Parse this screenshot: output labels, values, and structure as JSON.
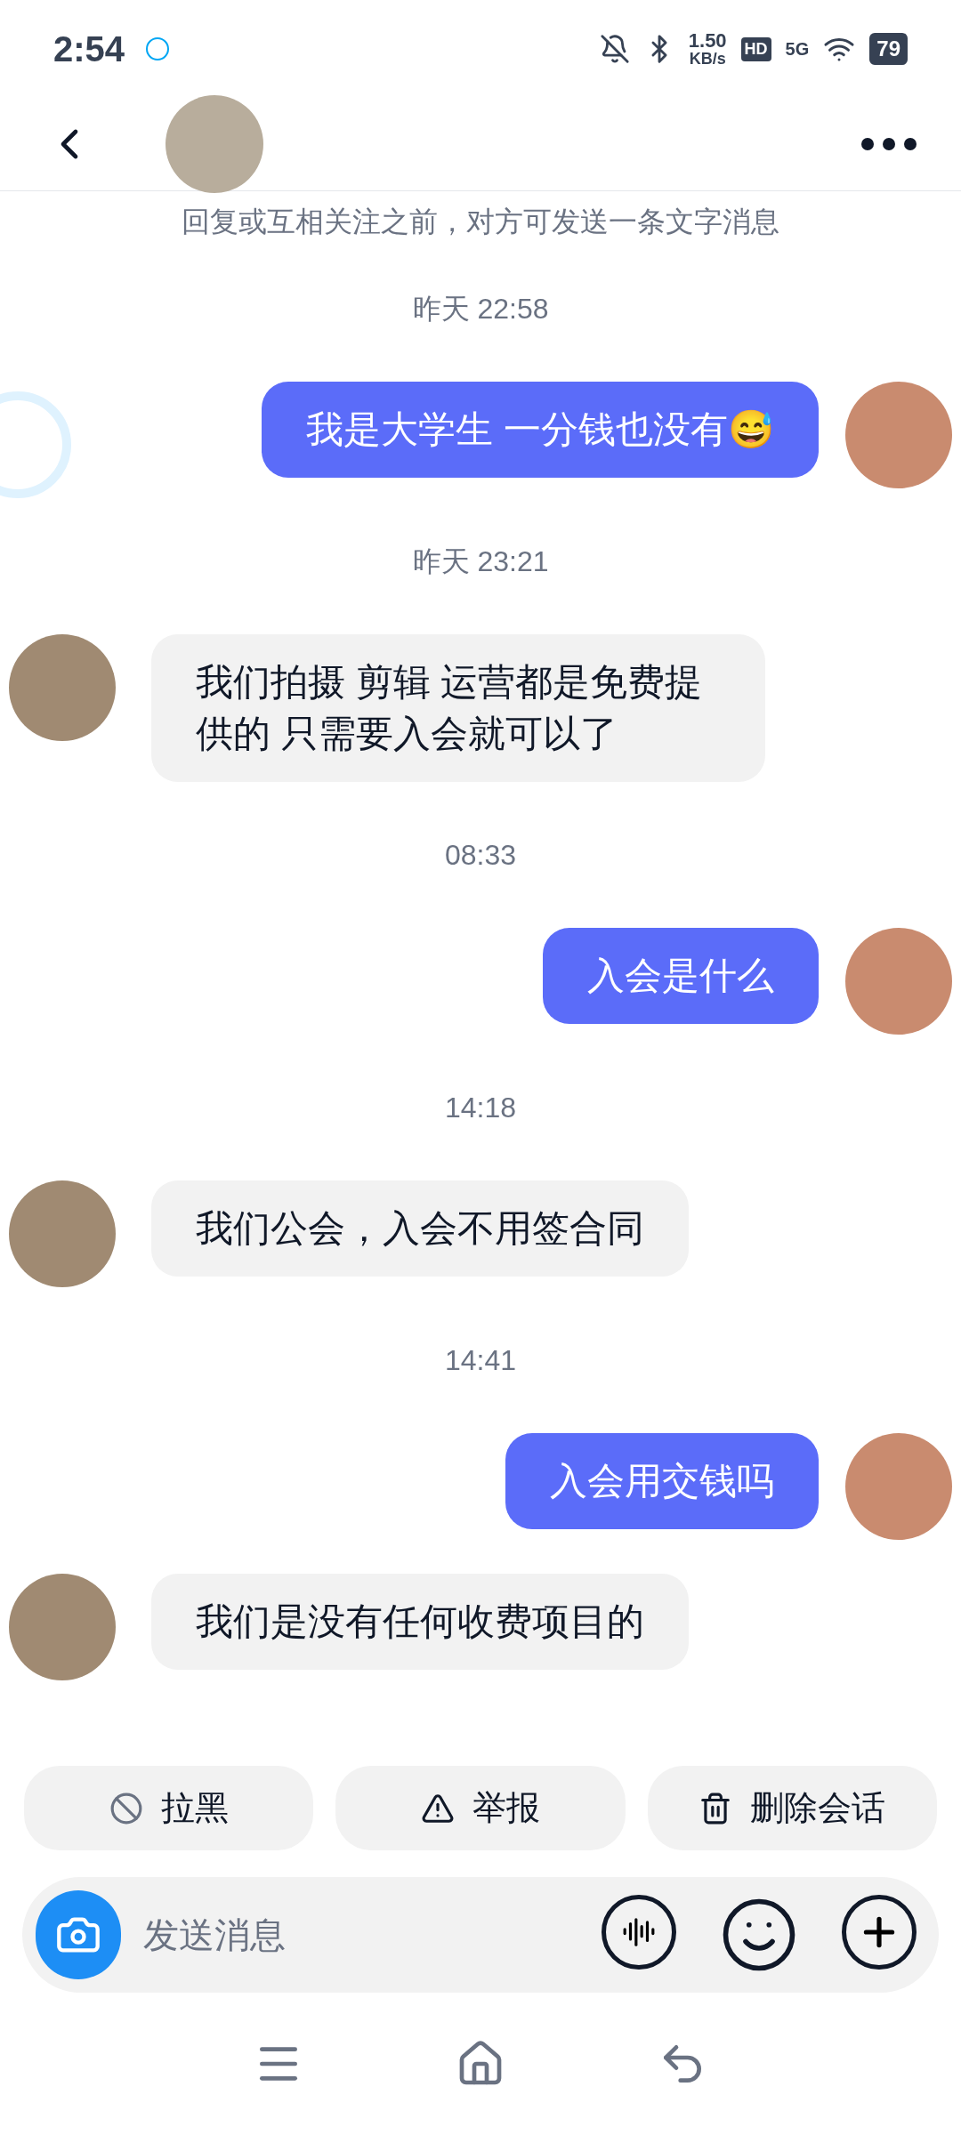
{
  "status_bar": {
    "time": "2:54",
    "speed_value": "1.50",
    "speed_unit": "KB/s",
    "hd": "HD",
    "network": "5G",
    "battery": "79"
  },
  "notice": "回复或互相关注之前，对方可发送一条文字消息",
  "messages": [
    {
      "kind": "time",
      "text": "昨天 22:58"
    },
    {
      "kind": "sent",
      "text": "我是大学生 一分钱也没有😅"
    },
    {
      "kind": "time",
      "text": "昨天 23:21"
    },
    {
      "kind": "received",
      "text": "我们拍摄 剪辑 运营都是免费提供的 只需要入会就可以了"
    },
    {
      "kind": "time",
      "text": "08:33"
    },
    {
      "kind": "sent",
      "text": "入会是什么"
    },
    {
      "kind": "time",
      "text": "14:18"
    },
    {
      "kind": "received",
      "text": "我们公会，入会不用签合同"
    },
    {
      "kind": "time",
      "text": "14:41"
    },
    {
      "kind": "sent",
      "text": "入会用交钱吗"
    },
    {
      "kind": "received",
      "text": "我们是没有任何收费项目的"
    }
  ],
  "actions": [
    {
      "kind": "block",
      "label": "拉黑"
    },
    {
      "kind": "report",
      "label": "举报"
    },
    {
      "kind": "delete",
      "label": "删除会话"
    }
  ],
  "input": {
    "placeholder": "发送消息"
  }
}
